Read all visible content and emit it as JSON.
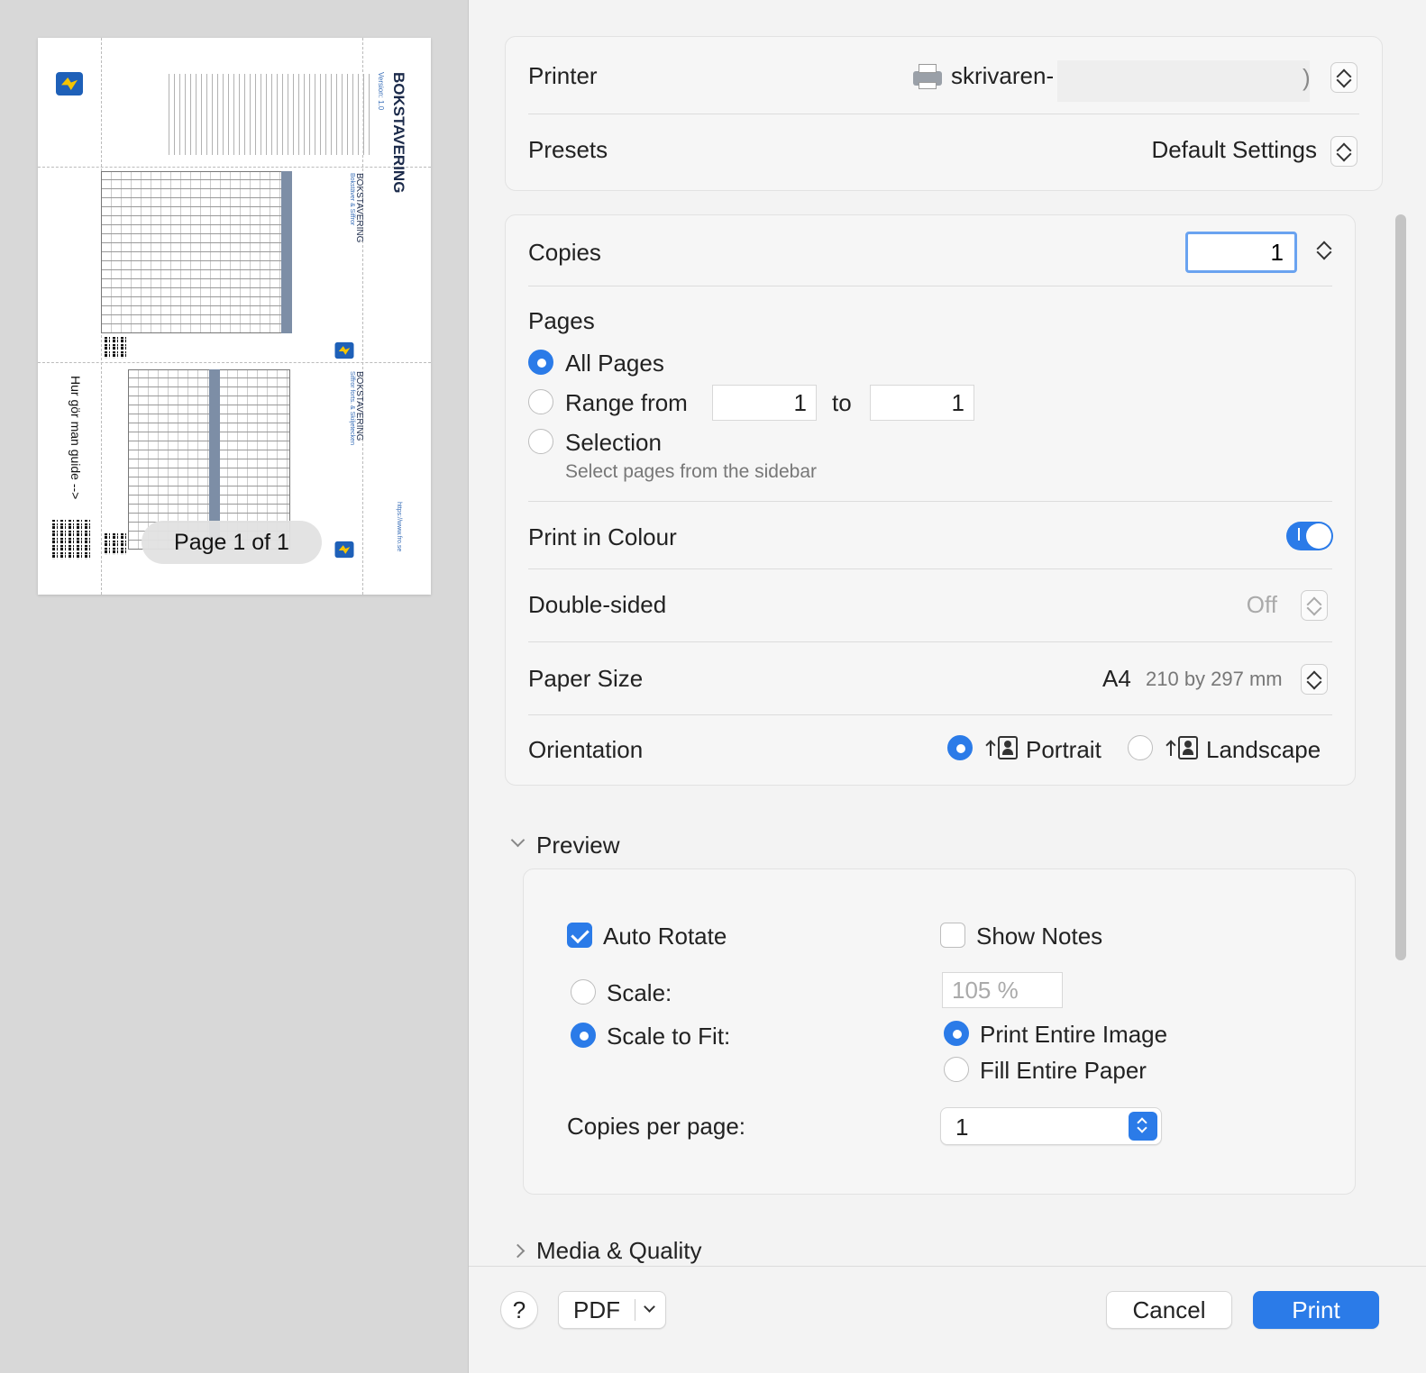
{
  "preview_pane": {
    "page_indicator": "Page 1 of 1",
    "doc": {
      "title": "BOKSTAVERING",
      "version": "Version: 1.0",
      "subtitle_1": "Bokstäver & Siffror",
      "subtitle_2": "Siffror forts. & Skiljetecken",
      "side_text": "Hur gör man guide -->",
      "url": "https://www.fro.se",
      "logo_text": "FRO"
    }
  },
  "printer": {
    "label": "Printer",
    "value": "skrivaren-",
    "suffix": ")"
  },
  "presets": {
    "label": "Presets",
    "value": "Default Settings"
  },
  "copies": {
    "label": "Copies",
    "value": "1"
  },
  "pages": {
    "label": "Pages",
    "all_pages": "All Pages",
    "range_from": "Range from",
    "range_start": "1",
    "to": "to",
    "range_end": "1",
    "selection": "Selection",
    "selection_hint": "Select pages from the sidebar"
  },
  "colour": {
    "label": "Print in Colour",
    "enabled": true
  },
  "double_sided": {
    "label": "Double-sided",
    "value": "Off"
  },
  "paper_size": {
    "label": "Paper Size",
    "value": "A4",
    "detail": "210 by 297 mm"
  },
  "orientation": {
    "label": "Orientation",
    "portrait": "Portrait",
    "landscape": "Landscape",
    "selected": "Portrait"
  },
  "preview_section": {
    "title": "Preview",
    "auto_rotate": "Auto Rotate",
    "show_notes": "Show Notes",
    "scale": "Scale:",
    "scale_value": "105 %",
    "scale_to_fit": "Scale to Fit:",
    "print_entire_image": "Print Entire Image",
    "fill_entire_paper": "Fill Entire Paper",
    "copies_per_page": "Copies per page:",
    "copies_per_page_value": "1"
  },
  "media_quality": {
    "title": "Media & Quality"
  },
  "footer": {
    "help": "?",
    "pdf": "PDF",
    "cancel": "Cancel",
    "print": "Print"
  },
  "colors": {
    "accent": "#2b7be8"
  }
}
